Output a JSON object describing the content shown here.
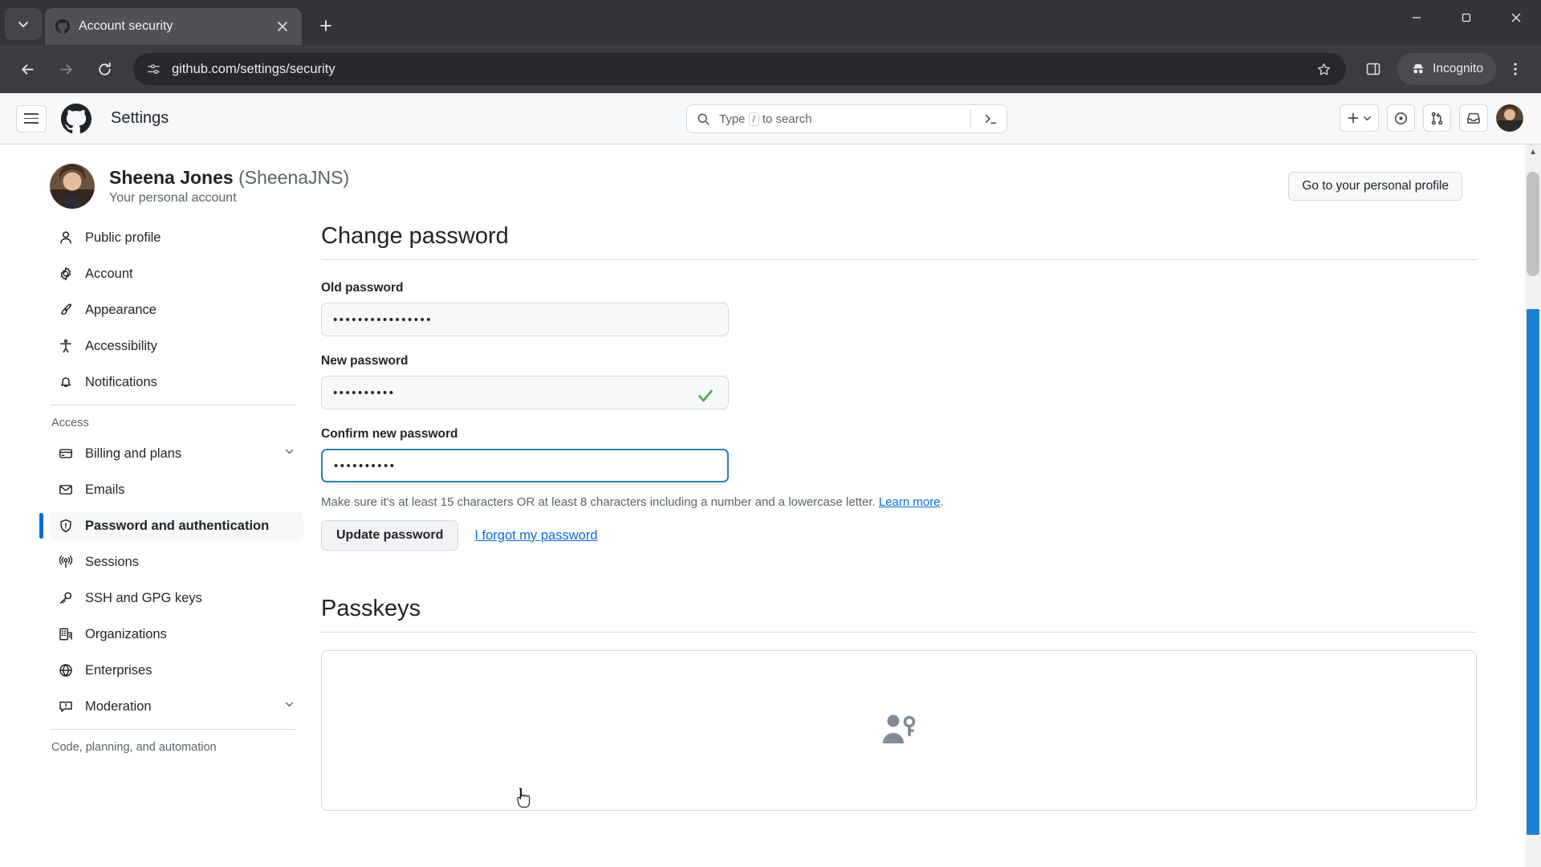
{
  "browser": {
    "tab": {
      "title": "Account security",
      "favicon": "github-icon",
      "close_icon": "close-icon"
    },
    "tab_list_icon": "chevron-down-icon",
    "new_tab_icon": "plus-icon",
    "window_controls": {
      "minimize": "minimize-icon",
      "maximize": "maximize-icon",
      "close": "close-icon"
    },
    "nav": {
      "back": "back-arrow-icon",
      "forward": "forward-arrow-icon",
      "reload": "reload-icon"
    },
    "omnibox": {
      "site_info_icon": "site-settings-icon",
      "url": "github.com/settings/security",
      "star_icon": "bookmark-star-icon"
    },
    "side_panel_icon": "side-panel-icon",
    "incognito_label": "Incognito",
    "incognito_icon": "incognito-icon",
    "menu_icon": "three-dot-menu-icon"
  },
  "gh_header": {
    "hamburger_icon": "hamburger-menu-icon",
    "logo_icon": "github-logo-icon",
    "title": "Settings",
    "search": {
      "icon": "search-icon",
      "placeholder_prefix": "Type",
      "placeholder_key": "/",
      "placeholder_suffix": "to search",
      "cli_icon": "command-palette-icon"
    },
    "actions": {
      "create_new": "plus-icon",
      "create_new_chevron": "chevron-down-icon",
      "issues": "issues-icon",
      "pull_requests": "pull-request-icon",
      "inbox": "inbox-icon",
      "avatar": "user-avatar"
    }
  },
  "profile": {
    "name": "Sheena Jones",
    "handle": "(SheenaJNS)",
    "subtitle": "Your personal account",
    "goto_profile_button": "Go to your personal profile",
    "avatar": "user-avatar"
  },
  "sidebar": {
    "items_top": [
      {
        "label": "Public profile",
        "icon": "person-icon",
        "selected": false,
        "chevron": false
      },
      {
        "label": "Account",
        "icon": "gear-icon",
        "selected": false,
        "chevron": false
      },
      {
        "label": "Appearance",
        "icon": "paintbrush-icon",
        "selected": false,
        "chevron": false
      },
      {
        "label": "Accessibility",
        "icon": "accessibility-icon",
        "selected": false,
        "chevron": false
      },
      {
        "label": "Notifications",
        "icon": "bell-icon",
        "selected": false,
        "chevron": false
      }
    ],
    "group_access_title": "Access",
    "items_access": [
      {
        "label": "Billing and plans",
        "icon": "credit-card-icon",
        "selected": false,
        "chevron": true
      },
      {
        "label": "Emails",
        "icon": "mail-icon",
        "selected": false,
        "chevron": false
      },
      {
        "label": "Password and authentication",
        "icon": "shield-lock-icon",
        "selected": true,
        "chevron": false
      },
      {
        "label": "Sessions",
        "icon": "broadcast-icon",
        "selected": false,
        "chevron": false
      },
      {
        "label": "SSH and GPG keys",
        "icon": "key-icon",
        "selected": false,
        "chevron": false
      },
      {
        "label": "Organizations",
        "icon": "organization-icon",
        "selected": false,
        "chevron": false
      },
      {
        "label": "Enterprises",
        "icon": "globe-icon",
        "selected": false,
        "chevron": false
      },
      {
        "label": "Moderation",
        "icon": "report-icon",
        "selected": false,
        "chevron": true
      }
    ],
    "group_code_title": "Code, planning, and automation"
  },
  "main": {
    "change_password": {
      "title": "Change password",
      "old_label": "Old password",
      "old_value": "••••••••••••••••",
      "new_label": "New password",
      "new_value": "••••••••••",
      "new_valid_icon": "checkmark-icon",
      "confirm_label": "Confirm new password",
      "confirm_value": "••••••••••",
      "hint_text": "Make sure it's at least 15 characters OR at least 8 characters including a number and a lowercase letter.",
      "hint_link": "Learn more",
      "hint_link_suffix": ".",
      "update_button": "Update password",
      "forgot_link": "I forgot my password"
    },
    "passkeys": {
      "title": "Passkeys",
      "empty_icon": "passkey-person-key-icon"
    }
  },
  "colors": {
    "accent": "#0969da",
    "focus_border": "#2a7fb8",
    "success": "#4aa94a",
    "border": "#d1d9e0",
    "muted_text": "#59636e",
    "scrollbar_highlight": "#1b7fd4"
  }
}
